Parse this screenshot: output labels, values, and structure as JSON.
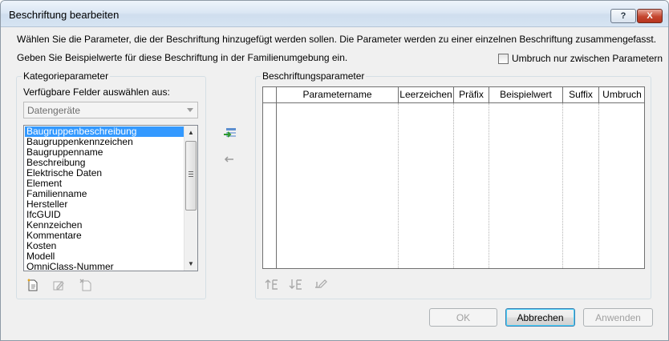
{
  "window": {
    "title": "Beschriftung bearbeiten"
  },
  "titlebar_buttons": {
    "help": "?",
    "close": "X"
  },
  "intro": {
    "line1": "Wählen Sie die Parameter, die der Beschriftung hinzugefügt werden sollen. Die Parameter werden zu einer einzelnen Beschriftung zusammengefasst.",
    "line2": "Geben Sie Beispielwerte für diese Beschriftung in der Familienumgebung ein."
  },
  "wrap_option": {
    "label": "Umbruch nur zwischen Parametern",
    "checked": false
  },
  "category_panel": {
    "title": "Kategorieparameter",
    "fields_label": "Verfügbare Felder auswählen aus:",
    "category_select": "Datengeräte",
    "fields": [
      "Baugruppenbeschreibung",
      "Baugruppenkennzeichen",
      "Baugruppenname",
      "Beschreibung",
      "Elektrische Daten",
      "Element",
      "Familienname",
      "Hersteller",
      "IfcGUID",
      "Kennzeichen",
      "Kommentare",
      "Kosten",
      "Modell",
      "OmniClass-Nummer"
    ],
    "selected_field": "Baugruppenbeschreibung",
    "tools": [
      "new-parameter-icon",
      "edit-parameter-icon",
      "delete-parameter-icon"
    ]
  },
  "move_buttons": [
    "add-parameter-arrow-icon",
    "remove-parameter-arrow-icon"
  ],
  "label_panel": {
    "title": "Beschriftungsparameter",
    "columns": [
      "Parametername",
      "Leerzeichen",
      "Präfix",
      "Beispielwert",
      "Suffix",
      "Umbruch"
    ],
    "rows": [],
    "tools": [
      "move-up-icon",
      "move-down-icon",
      "edit-format-icon"
    ]
  },
  "buttons": {
    "ok": "OK",
    "cancel": "Abbrechen",
    "apply": "Anwenden"
  },
  "colors": {
    "selection": "#3399ff",
    "titlebar": "#dbe7f4",
    "dialog_bg": "#f0f0f0"
  }
}
